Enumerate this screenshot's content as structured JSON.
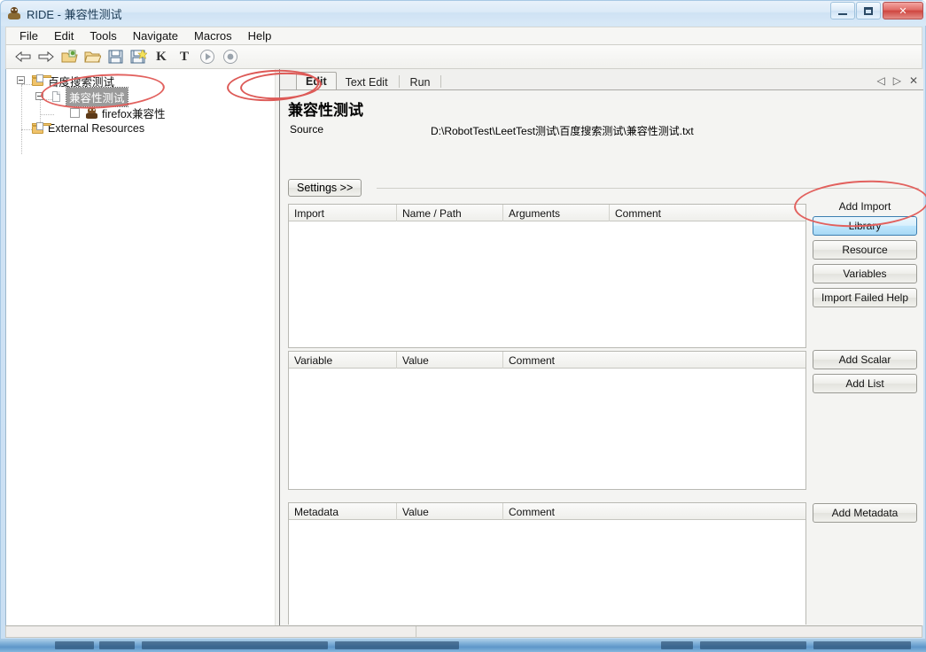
{
  "window": {
    "title": "RIDE - 兼容性测试",
    "app_icon": "robot-icon",
    "controls": {
      "minimize": "minimize-icon",
      "maximize": "maximize-icon",
      "close": "✕"
    }
  },
  "menubar": {
    "items": [
      {
        "label": "File"
      },
      {
        "label": "Edit"
      },
      {
        "label": "Tools"
      },
      {
        "label": "Navigate"
      },
      {
        "label": "Macros"
      },
      {
        "label": "Help"
      }
    ]
  },
  "toolbar": {
    "items": [
      {
        "name": "back-arrow-icon",
        "label": ""
      },
      {
        "name": "forward-arrow-icon",
        "label": ""
      },
      {
        "name": "open-folder-green-icon",
        "label": ""
      },
      {
        "name": "open-folder-icon",
        "label": ""
      },
      {
        "name": "save-icon",
        "label": ""
      },
      {
        "name": "save-all-icon",
        "label": ""
      },
      {
        "name": "search-keyword-icon",
        "label": "K"
      },
      {
        "name": "search-test-icon",
        "label": "T"
      },
      {
        "name": "run-icon",
        "label": ""
      },
      {
        "name": "stop-icon",
        "label": ""
      }
    ]
  },
  "tree": {
    "nodes": [
      {
        "label": "百度搜索测试",
        "icon": "suite-folder-icon",
        "selected": false,
        "expanded": true
      },
      {
        "label": "兼容性测试",
        "icon": "test-document-icon",
        "selected": true,
        "expanded": true
      },
      {
        "label": "firefox兼容性",
        "icon": "test-case-icon",
        "selected": false,
        "checkbox": true
      },
      {
        "label": "External Resources",
        "icon": "resources-folder-icon",
        "selected": false
      }
    ]
  },
  "editor": {
    "tabs": [
      {
        "label": "Edit",
        "active": true
      },
      {
        "label": "Text Edit",
        "active": false
      },
      {
        "label": "Run",
        "active": false
      }
    ],
    "tab_controls": {
      "prev": "◁",
      "next": "▷",
      "close": "✕"
    },
    "heading": "兼容性测试",
    "source_label": "Source",
    "source_value": "D:\\RobotTest\\LeetTest测试\\百度搜索测试\\兼容性测试.txt",
    "settings_button": "Settings >>",
    "import_grid": {
      "headers": [
        "Import",
        "Name / Path",
        "Arguments",
        "Comment"
      ],
      "rows": []
    },
    "variable_grid": {
      "headers": [
        "Variable",
        "Value",
        "Comment"
      ],
      "rows": []
    },
    "metadata_grid": {
      "headers": [
        "Metadata",
        "Value",
        "Comment"
      ],
      "rows": []
    },
    "side_panel": {
      "add_import_label": "Add Import",
      "import_buttons": [
        {
          "label": "Library",
          "highlighted": true
        },
        {
          "label": "Resource",
          "highlighted": false
        },
        {
          "label": "Variables",
          "highlighted": false
        },
        {
          "label": "Import Failed Help",
          "highlighted": false
        }
      ],
      "variable_buttons": [
        {
          "label": "Add Scalar"
        },
        {
          "label": "Add List"
        }
      ],
      "metadata_buttons": [
        {
          "label": "Add Metadata"
        }
      ]
    }
  },
  "annotations": {
    "color": "#e2615e",
    "marks": [
      {
        "name": "tree-selection-highlight"
      },
      {
        "name": "edit-tab-highlight"
      },
      {
        "name": "library-button-highlight"
      }
    ]
  },
  "statusbar": {
    "left_text": "",
    "right_text": ""
  }
}
